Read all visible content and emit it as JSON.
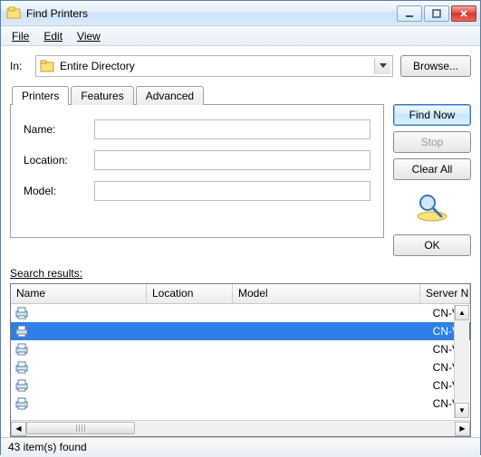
{
  "window": {
    "title": "Find Printers",
    "menu": {
      "file": "File",
      "edit": "Edit",
      "view": "View"
    }
  },
  "in_row": {
    "label": "In:",
    "directory": "Entire Directory",
    "browse": "Browse..."
  },
  "tabs": {
    "printers": "Printers",
    "features": "Features",
    "advanced": "Advanced"
  },
  "form": {
    "name_label": "Name:",
    "name_value": "",
    "location_label": "Location:",
    "location_value": "",
    "model_label": "Model:",
    "model_value": ""
  },
  "actions": {
    "find_now": "Find Now",
    "stop": "Stop",
    "clear_all": "Clear All",
    "ok": "OK"
  },
  "results": {
    "label": "Search results:",
    "columns": {
      "name": "Name",
      "location": "Location",
      "model": "Model",
      "server": "Server N"
    },
    "rows": [
      {
        "name": "",
        "location": "",
        "model": "",
        "server": "CN-VM",
        "selected": false
      },
      {
        "name": "",
        "location": "",
        "model": "",
        "server": "CN-VM",
        "selected": true
      },
      {
        "name": "",
        "location": "",
        "model": "",
        "server": "CN-VM",
        "selected": false
      },
      {
        "name": "",
        "location": "",
        "model": "",
        "server": "CN-VM",
        "selected": false
      },
      {
        "name": "",
        "location": "",
        "model": "",
        "server": "CN-VM",
        "selected": false
      },
      {
        "name": "",
        "location": "",
        "model": "",
        "server": "CN-VM",
        "selected": false
      }
    ],
    "status": "43 item(s) found"
  }
}
